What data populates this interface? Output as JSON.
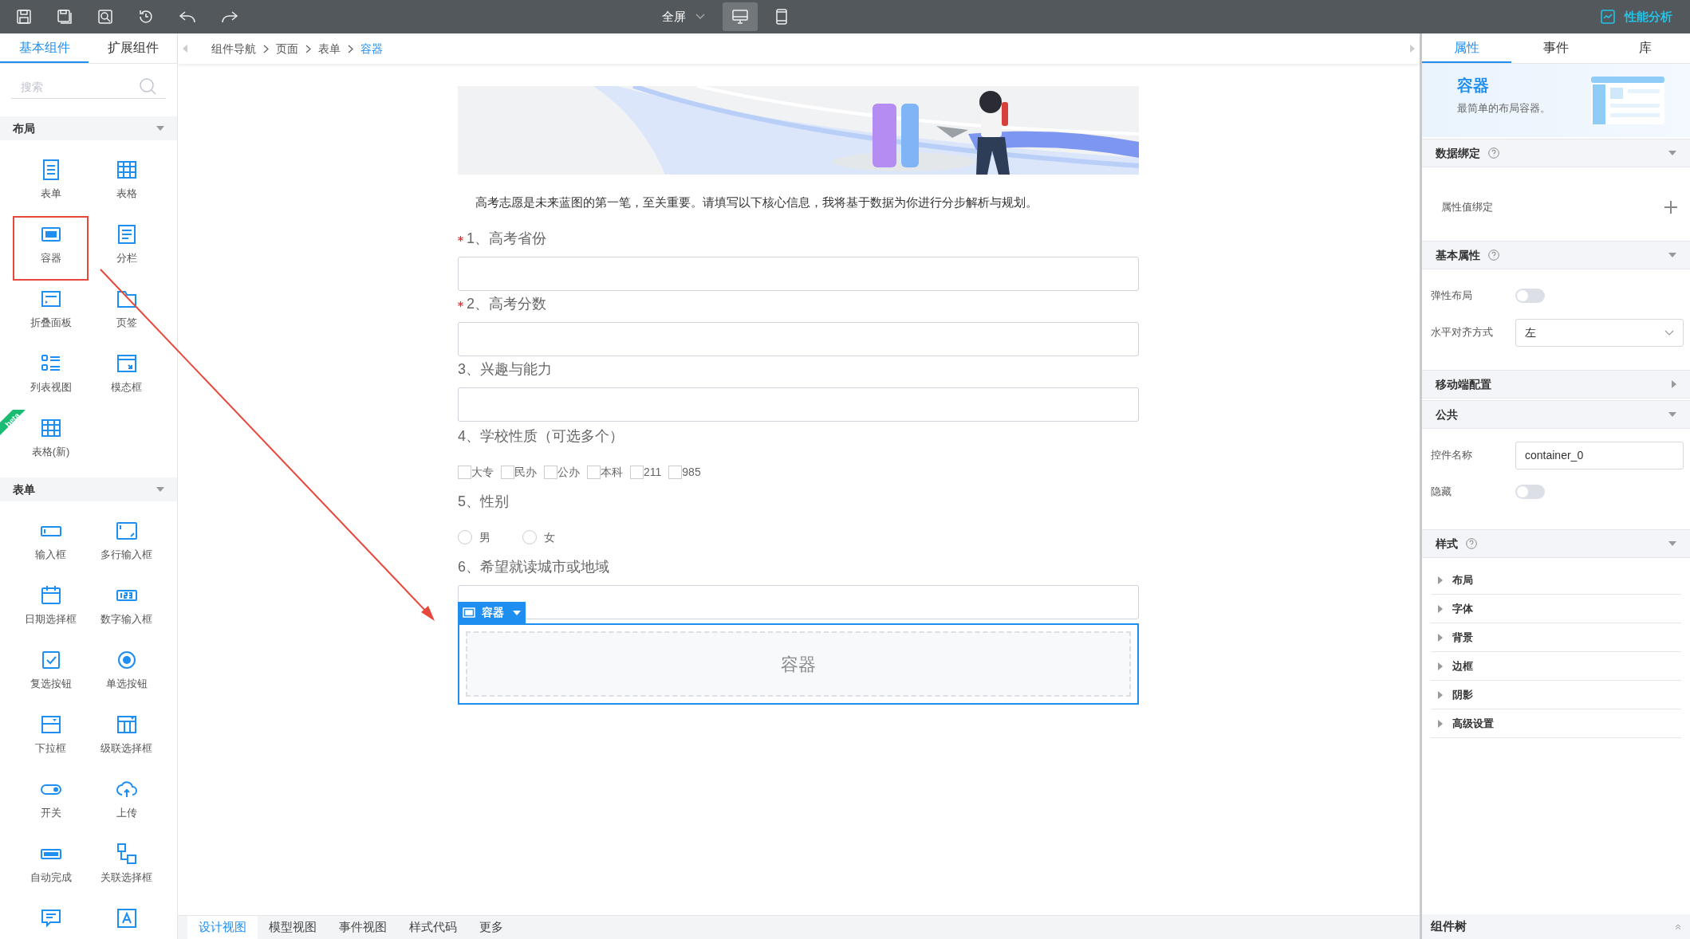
{
  "toolbar": {
    "view_mode": "全屏",
    "devices": [
      {
        "kind": "desktop",
        "selected": true
      },
      {
        "kind": "mobile",
        "selected": false
      }
    ],
    "performance": "性能分析"
  },
  "palette": {
    "tabs": [
      {
        "label": "基本组件",
        "selected": true
      },
      {
        "label": "扩展组件",
        "selected": false
      }
    ],
    "search": {
      "placeholder": "搜索"
    },
    "sections": [
      {
        "title": "布局",
        "expanded": true,
        "items": [
          {
            "label": "表单",
            "kind": "form",
            "selected": false
          },
          {
            "label": "表格",
            "kind": "table",
            "selected": false
          },
          {
            "label": "容器",
            "kind": "container",
            "selected": true
          },
          {
            "label": "分栏",
            "kind": "columns",
            "selected": false
          },
          {
            "label": "折叠面板",
            "kind": "collapse",
            "selected": false
          },
          {
            "label": "页签",
            "kind": "tabs",
            "selected": false
          },
          {
            "label": "列表视图",
            "kind": "list",
            "selected": false
          },
          {
            "label": "模态框",
            "kind": "modal",
            "selected": false
          },
          {
            "label": "表格(新)",
            "kind": "table",
            "selected": false,
            "badge": "beta"
          }
        ]
      },
      {
        "title": "表单",
        "expanded": true,
        "items": [
          {
            "label": "输入框",
            "kind": "input",
            "selected": false
          },
          {
            "label": "多行输入框",
            "kind": "textarea",
            "selected": false
          },
          {
            "label": "日期选择框",
            "kind": "date",
            "selected": false
          },
          {
            "label": "数字输入框",
            "kind": "number",
            "selected": false
          },
          {
            "label": "复选按钮",
            "kind": "checkbox",
            "selected": false
          },
          {
            "label": "单选按钮",
            "kind": "radio",
            "selected": false
          },
          {
            "label": "下拉框",
            "kind": "select",
            "selected": false
          },
          {
            "label": "级联选择框",
            "kind": "cascader",
            "selected": false
          },
          {
            "label": "开关",
            "kind": "switch",
            "selected": false
          },
          {
            "label": "上传",
            "kind": "upload",
            "selected": false
          },
          {
            "label": "自动完成",
            "kind": "autocomplete",
            "selected": false
          },
          {
            "label": "关联选择框",
            "kind": "relation",
            "selected": false
          },
          {
            "kind": "comment",
            "selected": false
          },
          {
            "kind": "text",
            "selected": false
          }
        ]
      }
    ]
  },
  "breadcrumb": [
    {
      "label": "组件导航",
      "current": false
    },
    {
      "label": "页面",
      "current": false
    },
    {
      "label": "表单",
      "current": false
    },
    {
      "label": "容器",
      "current": true
    }
  ],
  "form": {
    "intro": "高考志愿是未来蓝图的第一笔，至关重要。请填写以下核心信息，我将基于数据为你进行分步解析与规划。",
    "questions": [
      {
        "kind": "text",
        "label": "1、高考省份",
        "required": true
      },
      {
        "kind": "text",
        "label": "2、高考分数",
        "required": true
      },
      {
        "kind": "text",
        "label": "3、兴趣与能力",
        "required": false
      },
      {
        "kind": "checkbox",
        "label": "4、学校性质（可选多个）",
        "required": false,
        "options": [
          {
            "label": "大专",
            "checked": false
          },
          {
            "label": "民办",
            "checked": false
          },
          {
            "label": "公办",
            "checked": false
          },
          {
            "label": "本科",
            "checked": false
          },
          {
            "label": "211",
            "checked": false
          },
          {
            "label": "985",
            "checked": false
          }
        ]
      },
      {
        "kind": "radio",
        "label": "5、性别",
        "required": false,
        "options": [
          {
            "label": "男",
            "selected": false
          },
          {
            "label": "女",
            "selected": false
          }
        ]
      },
      {
        "kind": "text",
        "label": "6、希望就读城市或地域",
        "required": false
      }
    ],
    "container": {
      "toolbar_label": "容器",
      "placeholder": "容器",
      "selected": true
    }
  },
  "view_tabs": [
    {
      "label": "设计视图",
      "selected": true
    },
    {
      "label": "模型视图",
      "selected": false
    },
    {
      "label": "事件视图",
      "selected": false
    },
    {
      "label": "样式代码",
      "selected": false
    },
    {
      "label": "更多",
      "selected": false
    }
  ],
  "inspector": {
    "tabs": [
      {
        "label": "属性",
        "selected": true
      },
      {
        "label": "事件",
        "selected": false
      },
      {
        "label": "库",
        "selected": false
      }
    ],
    "header": {
      "title": "容器",
      "description": "最简单的布局容器。"
    },
    "sections": [
      {
        "title": "数据绑定",
        "help": true,
        "expanded": true,
        "rows": [
          {
            "kind": "binding",
            "label": "属性值绑定"
          }
        ]
      },
      {
        "title": "基本属性",
        "help": true,
        "expanded": true,
        "rows": [
          {
            "kind": "switch",
            "label": "弹性布局",
            "on": false
          },
          {
            "kind": "select",
            "label": "水平对齐方式",
            "value": "左"
          }
        ]
      },
      {
        "title": "移动端配置",
        "help": false,
        "expanded": false
      },
      {
        "title": "公共",
        "help": false,
        "expanded": true,
        "rows": [
          {
            "kind": "input",
            "label": "控件名称",
            "value": "container_0"
          },
          {
            "kind": "switch",
            "label": "隐藏",
            "on": false
          }
        ]
      },
      {
        "title": "样式",
        "help": true,
        "expanded": true,
        "rows": [
          {
            "kind": "group",
            "label": "布局",
            "expanded": false
          },
          {
            "kind": "group",
            "label": "字体",
            "expanded": false
          },
          {
            "kind": "group",
            "label": "背景",
            "expanded": false
          },
          {
            "kind": "group",
            "label": "边框",
            "expanded": false
          },
          {
            "kind": "group",
            "label": "阴影",
            "expanded": false
          },
          {
            "kind": "group",
            "label": "高级设置",
            "expanded": false
          }
        ]
      }
    ],
    "component_tree": {
      "label": "组件树",
      "expanded": false
    }
  }
}
